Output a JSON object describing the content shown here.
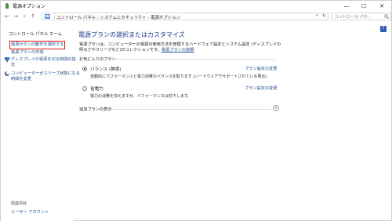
{
  "window": {
    "title": "電源オプション",
    "minimize": "—",
    "maximize": "☐",
    "close": "✕"
  },
  "address": {
    "back": "←",
    "forward": "→",
    "up_list": "∨",
    "up": "↑",
    "crumbs": [
      "コントロール パネル",
      "システムとセキュリティ",
      "電源オプション"
    ],
    "separator": "›",
    "dropdown": "∨",
    "refresh": "↻"
  },
  "search": {
    "placeholder": "コントロール パネ..."
  },
  "sidebar": {
    "home": "コントロール パネル ホーム",
    "tasks": [
      "電源ボタンの動作を選択する",
      "電源プランの作成",
      "ディスプレイの電源を切る時間の指\n定",
      "コンピューターがスリープ状態になる\n時間を変更"
    ],
    "related_title": "関連項目",
    "related_link": "ユーザー アカウント"
  },
  "main": {
    "heading": "電源プランの選択またはカスタマイズ",
    "desc": "電源プランは、コンピューターの電源の使用方法を管理するハードウェア設定とシステム設定 (ディスプレイの明るさやスリープなど)のコレクションです。",
    "desc_link": "電源プランの詳細",
    "favorites_label": "お気に入りのプラン",
    "plans": [
      {
        "name": "バランス (推奨)",
        "desc": "自動的にパフォーマンスと電力消費のバランスを取ります (ハードウェアでサポートされている場合)",
        "change": "プラン設定の変更",
        "selected": true
      },
      {
        "name": "省電力",
        "desc": "電力の消費を抑えますが、パフォーマンスは低下します。",
        "change": "プラン設定の変更",
        "selected": false
      }
    ],
    "hidden_label": "追加プランの表示",
    "expand": "∨",
    "help": "?"
  },
  "colors": {
    "link": "#1f4e8c",
    "heading": "#1e3a8a",
    "highlight": "#e01616"
  }
}
